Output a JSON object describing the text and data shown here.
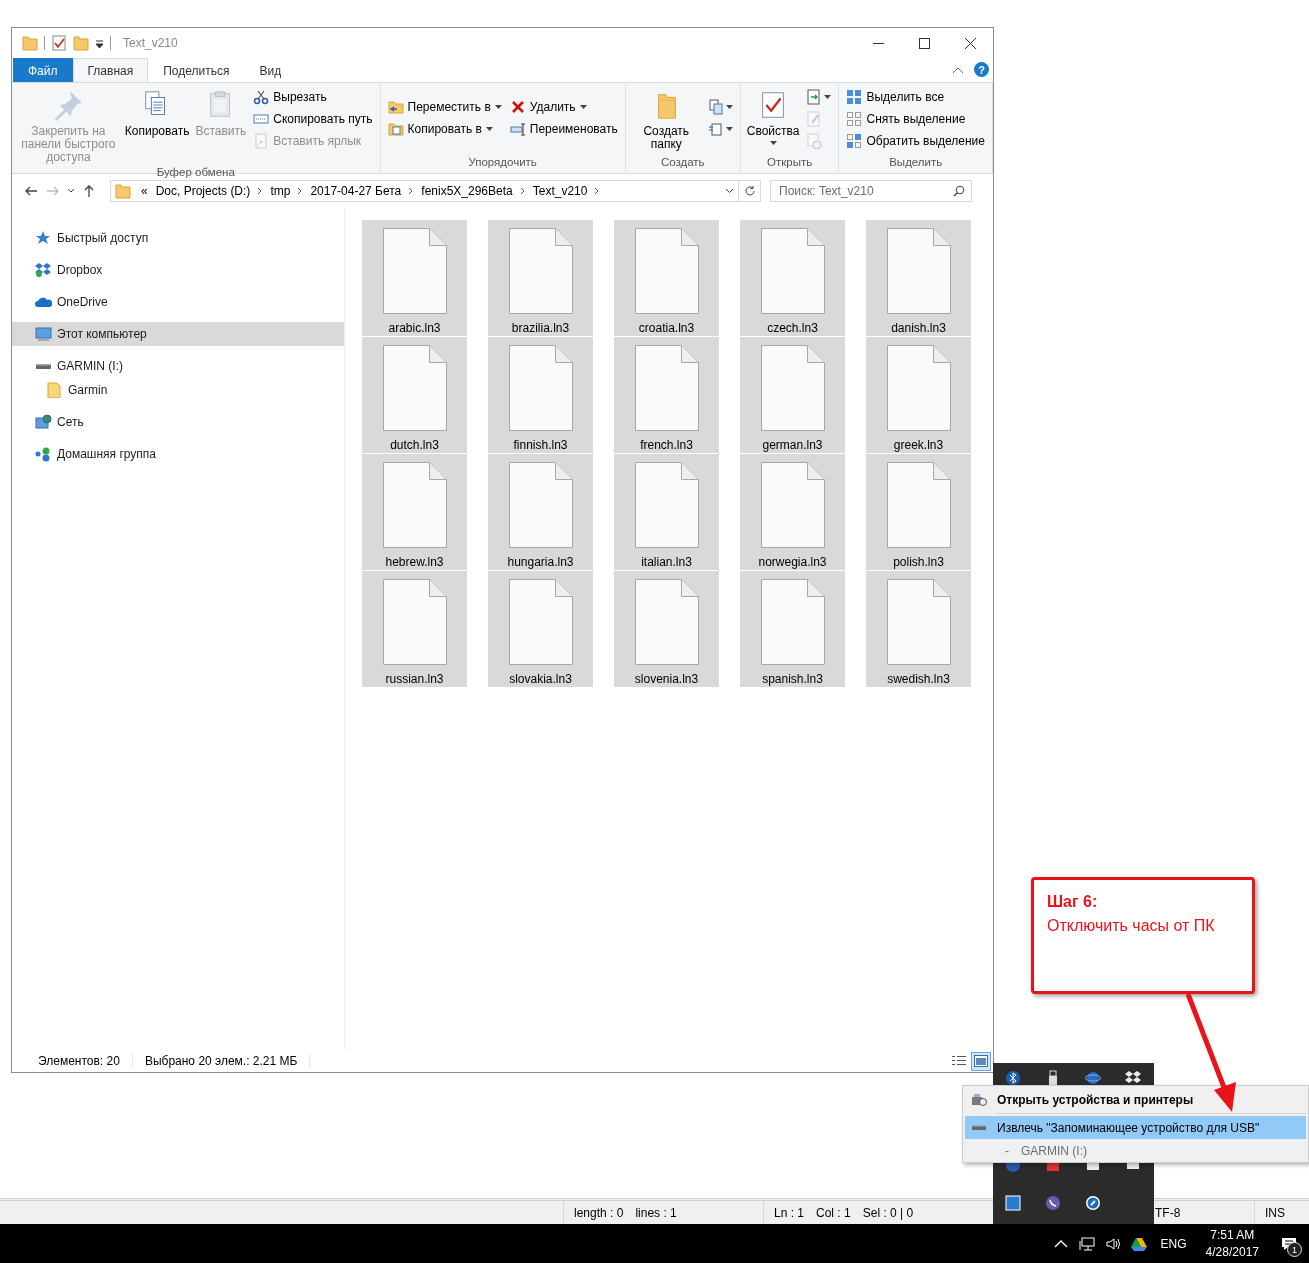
{
  "window": {
    "title": "Text_v210",
    "help": "?"
  },
  "ribbon_tabs": [
    {
      "label": "Файл",
      "kind": "file",
      "selected": false
    },
    {
      "label": "Главная",
      "kind": "tab",
      "selected": true
    },
    {
      "label": "Поделиться",
      "kind": "tab",
      "selected": false
    },
    {
      "label": "Вид",
      "kind": "tab",
      "selected": false
    }
  ],
  "ribbon_groups": [
    {
      "label": "Буфер обмена",
      "columns": [
        [
          {
            "kind": "large",
            "label": "Закрепить на панели быстрого доступа",
            "disabled": true
          }
        ],
        [
          {
            "kind": "large",
            "label": "Копировать",
            "disabled": false
          }
        ],
        [
          {
            "kind": "large",
            "label": "Вставить",
            "disabled": true
          }
        ],
        [
          {
            "kind": "small",
            "label": "Вырезать",
            "disabled": false
          },
          {
            "kind": "small",
            "label": "Скопировать путь",
            "disabled": false
          },
          {
            "kind": "small",
            "label": "Вставить ярлык",
            "disabled": true
          }
        ]
      ]
    },
    {
      "label": "Упорядочить",
      "columns": [
        [
          {
            "kind": "small",
            "label": "Переместить в",
            "disabled": false,
            "dropdown": true
          },
          {
            "kind": "small",
            "label": "Копировать в",
            "disabled": false,
            "dropdown": true
          }
        ],
        [
          {
            "kind": "small",
            "label": "Удалить",
            "disabled": false,
            "dropdown": true
          },
          {
            "kind": "small",
            "label": "Переименовать",
            "disabled": false
          }
        ]
      ]
    },
    {
      "label": "Создать",
      "columns": [
        [
          {
            "kind": "large",
            "label": "Создать папку",
            "disabled": false
          }
        ],
        [
          {
            "kind": "icon",
            "disabled": false,
            "dropdown": true
          },
          {
            "kind": "icon",
            "disabled": false,
            "dropdown": true
          }
        ]
      ]
    },
    {
      "label": "Открыть",
      "columns": [
        [
          {
            "kind": "large",
            "label": "Свойства",
            "disabled": false,
            "dropdown": true
          }
        ],
        [
          {
            "kind": "icon",
            "disabled": false,
            "dropdown": true
          },
          {
            "kind": "icon",
            "disabled": true
          },
          {
            "kind": "icon",
            "disabled": true
          }
        ]
      ]
    },
    {
      "label": "Выделить",
      "columns": [
        [
          {
            "kind": "small",
            "label": "Выделить все",
            "disabled": false
          },
          {
            "kind": "small",
            "label": "Снять выделение",
            "disabled": false
          },
          {
            "kind": "small",
            "label": "Обратить выделение",
            "disabled": false
          }
        ]
      ]
    }
  ],
  "address": {
    "overflow": "«",
    "segments": [
      "Doc, Projects (D:)",
      "tmp",
      "2017-04-27 Бета",
      "fenix5X_296Beta",
      "Text_v210"
    ]
  },
  "search": {
    "placeholder": "Поиск: Text_v210"
  },
  "nav": [
    {
      "label": "Быстрый доступ",
      "selected": false
    },
    {
      "label": "Dropbox",
      "selected": false
    },
    {
      "label": "OneDrive",
      "selected": false
    },
    {
      "label": "Этот компьютер",
      "selected": true
    },
    {
      "label": "GARMIN (I:)",
      "selected": false,
      "children": [
        {
          "label": "Garmin",
          "selected": false
        }
      ]
    },
    {
      "label": "Сеть",
      "selected": false
    },
    {
      "label": "Домашняя группа",
      "selected": false
    }
  ],
  "files": [
    {
      "name": "arabic.ln3",
      "selected": true
    },
    {
      "name": "brazilia.ln3",
      "selected": true
    },
    {
      "name": "croatia.ln3",
      "selected": true
    },
    {
      "name": "czech.ln3",
      "selected": true
    },
    {
      "name": "danish.ln3",
      "selected": true
    },
    {
      "name": "dutch.ln3",
      "selected": true
    },
    {
      "name": "finnish.ln3",
      "selected": true
    },
    {
      "name": "french.ln3",
      "selected": true
    },
    {
      "name": "german.ln3",
      "selected": true
    },
    {
      "name": "greek.ln3",
      "selected": true
    },
    {
      "name": "hebrew.ln3",
      "selected": true
    },
    {
      "name": "hungaria.ln3",
      "selected": true
    },
    {
      "name": "italian.ln3",
      "selected": true
    },
    {
      "name": "norwegia.ln3",
      "selected": true
    },
    {
      "name": "polish.ln3",
      "selected": true
    },
    {
      "name": "russian.ln3",
      "selected": true
    },
    {
      "name": "slovakia.ln3",
      "selected": true
    },
    {
      "name": "slovenia.ln3",
      "selected": true
    },
    {
      "name": "spanish.ln3",
      "selected": true
    },
    {
      "name": "swedish.ln3",
      "selected": true
    }
  ],
  "status_bar": {
    "items": [
      "Элементов: 20",
      "Выбрано 20 элем.: 2.21 МБ"
    ],
    "views": [
      {
        "kind": "details",
        "selected": false
      },
      {
        "kind": "large_icons",
        "selected": true
      }
    ]
  },
  "callout": {
    "title": "Шаг 6:",
    "text": "Отключить часы от ПК"
  },
  "context_menu": [
    {
      "kind": "item",
      "label": "Открыть устройства и принтеры",
      "bold": true,
      "highlighted": false
    },
    {
      "kind": "item",
      "label": "Извлечь \"Запоминающее устройство для USB\"",
      "bold": false,
      "highlighted": true
    },
    {
      "kind": "sub",
      "marker": "-",
      "label": "GARMIN (I:)"
    }
  ],
  "editor_status": [
    "length : 0",
    "lines : 1",
    "Ln : 1",
    "Col : 1",
    "Sel : 0 | 0",
    "TF-8",
    "INS"
  ],
  "taskbar": {
    "language": "ENG",
    "time": "7:51 AM",
    "date": "4/28/2017",
    "notifications": "1"
  }
}
